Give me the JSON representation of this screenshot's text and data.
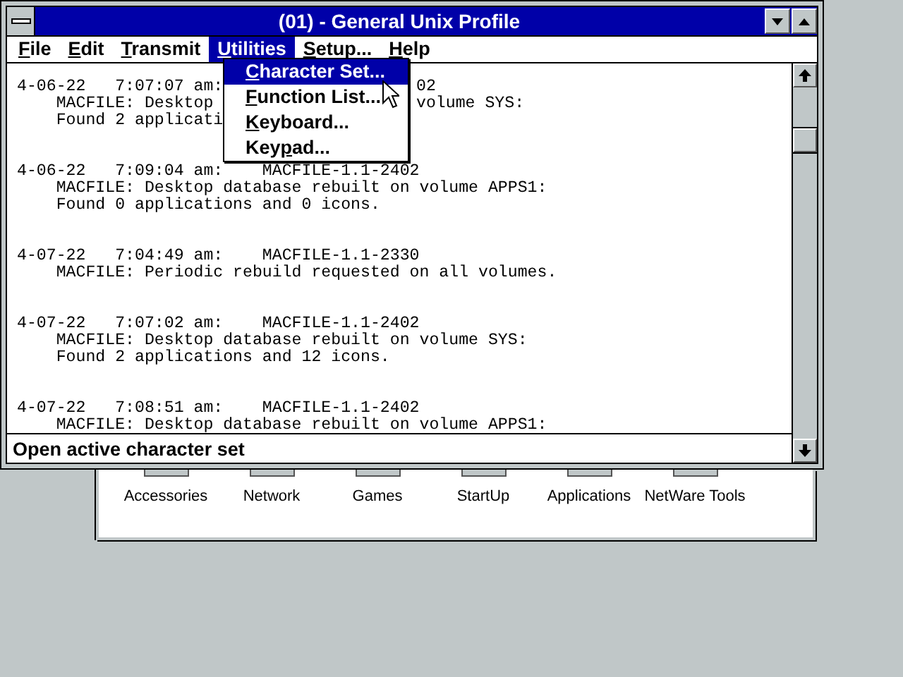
{
  "window": {
    "title": "(01) - General Unix Profile"
  },
  "menu_bar": [
    {
      "key": "F",
      "after": "ile",
      "selected": false
    },
    {
      "key": "E",
      "after": "dit",
      "selected": false
    },
    {
      "key": "T",
      "after": "ransmit",
      "selected": false
    },
    {
      "key": "U",
      "after": "tilities",
      "selected": true
    },
    {
      "key": "S",
      "after": "etup...",
      "selected": false
    },
    {
      "key": "H",
      "after": "elp",
      "selected": false
    }
  ],
  "dropdown": [
    {
      "key": "C",
      "after": "haracter Set...",
      "selected": true
    },
    {
      "key": "F",
      "after": "unction List...",
      "selected": false
    },
    {
      "key": "K",
      "after": "eyboard...",
      "selected": false
    },
    {
      "before": "Key",
      "key": "p",
      "after": "ad...",
      "selected": false
    }
  ],
  "log": [
    {
      "lines": [
        {
          "kind": "header",
          "segments": [
            "4-06-22   7:07:07 am:",
            "02"
          ]
        },
        {
          "kind": "detail",
          "segments": [
            "MACFILE: Desktop",
            "volume SYS:"
          ]
        },
        {
          "kind": "detail",
          "segments": [
            "Found 2 applicati"
          ]
        }
      ]
    },
    {
      "lines": [
        {
          "kind": "header",
          "segments": [
            "4-06-22   7:09:04 am:    MACFILE-1.1-2402"
          ]
        },
        {
          "kind": "detail",
          "segments": [
            "MACFILE: Desktop database rebuilt on volume APPS1:"
          ]
        },
        {
          "kind": "detail",
          "segments": [
            "Found 0 applications and 0 icons."
          ]
        }
      ]
    },
    {
      "lines": [
        {
          "kind": "header",
          "segments": [
            "4-07-22   7:04:49 am:    MACFILE-1.1-2330"
          ]
        },
        {
          "kind": "detail",
          "segments": [
            "MACFILE: Periodic rebuild requested on all volumes."
          ]
        }
      ]
    },
    {
      "lines": [
        {
          "kind": "header",
          "segments": [
            "4-07-22   7:07:02 am:    MACFILE-1.1-2402"
          ]
        },
        {
          "kind": "detail",
          "segments": [
            "MACFILE: Desktop database rebuilt on volume SYS:"
          ]
        },
        {
          "kind": "detail",
          "segments": [
            "Found 2 applications and 12 icons."
          ]
        }
      ]
    },
    {
      "lines": [
        {
          "kind": "header",
          "segments": [
            "4-07-22   7:08:51 am:    MACFILE-1.1-2402"
          ]
        },
        {
          "kind": "detail",
          "segments": [
            "MACFILE: Desktop database rebuilt on volume APPS1:"
          ]
        }
      ]
    }
  ],
  "status_bar": "Open active character set",
  "program_groups": [
    "Accessories",
    "Network",
    "Games",
    "StartUp",
    "Applications",
    "NetWare Tools"
  ]
}
